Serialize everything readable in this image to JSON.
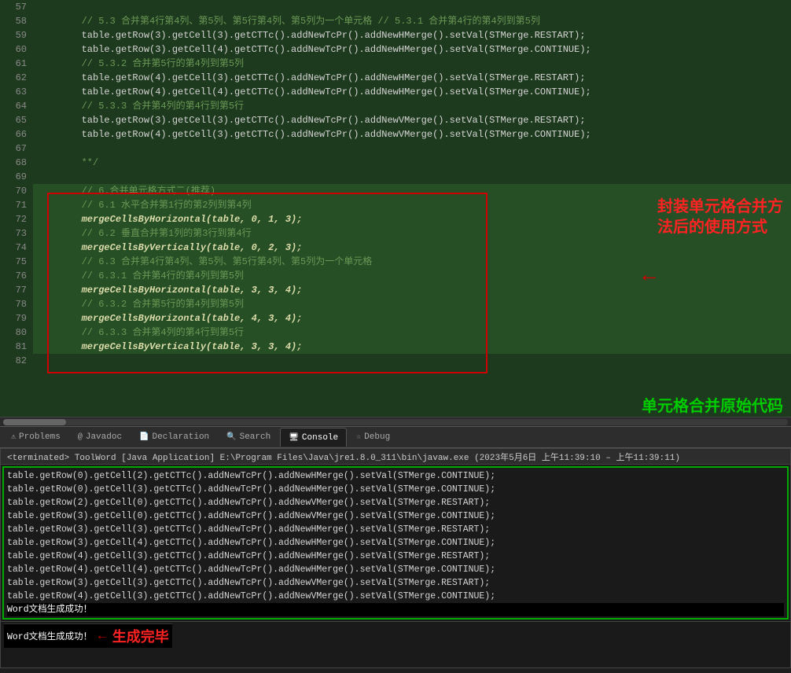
{
  "editor": {
    "lines": [
      {
        "num": "57",
        "content": "",
        "type": "normal"
      },
      {
        "num": "58",
        "content": "        // 5.3 合并第4行第4列、第5列、第5行第4列、第5列为一个单元格 // 5.3.1 合并第4行的第4列到第5列",
        "type": "comment"
      },
      {
        "num": "59",
        "content": "        table.getRow(3).getCell(3).getCTTc().addNewTcPr().addNewHMerge().setVal(STMerge.RESTART);",
        "type": "normal"
      },
      {
        "num": "60",
        "content": "        table.getRow(3).getCell(4).getCTTc().addNewTcPr().addNewHMerge().setVal(STMerge.CONTINUE);",
        "type": "normal"
      },
      {
        "num": "61",
        "content": "        // 5.3.2 合并第5行的第4列到第5列",
        "type": "comment"
      },
      {
        "num": "62",
        "content": "        table.getRow(4).getCell(3).getCTTc().addNewTcPr().addNewHMerge().setVal(STMerge.RESTART);",
        "type": "normal"
      },
      {
        "num": "63",
        "content": "        table.getRow(4).getCell(4).getCTTc().addNewTcPr().addNewHMerge().setVal(STMerge.CONTINUE);",
        "type": "normal"
      },
      {
        "num": "64",
        "content": "        // 5.3.3 合并第4列的第4行到第5行",
        "type": "comment"
      },
      {
        "num": "65",
        "content": "        table.getRow(3).getCell(3).getCTTc().addNewTcPr().addNewVMerge().setVal(STMerge.RESTART);",
        "type": "normal"
      },
      {
        "num": "66",
        "content": "        table.getRow(4).getCell(3).getCTTc().addNewTcPr().addNewVMerge().setVal(STMerge.CONTINUE);",
        "type": "normal"
      },
      {
        "num": "67",
        "content": "",
        "type": "normal"
      },
      {
        "num": "68",
        "content": "        **/",
        "type": "comment"
      },
      {
        "num": "69",
        "content": "",
        "type": "normal"
      },
      {
        "num": "70",
        "content": "        // 6.合并单元格方式二(推荐)",
        "type": "comment",
        "highlighted": true
      },
      {
        "num": "71",
        "content": "        // 6.1 水平合并第1行的第2列到第4列",
        "type": "comment",
        "highlighted": true
      },
      {
        "num": "72",
        "content": "        mergeCellsByHorizontal(table, 0, 1, 3);",
        "type": "method",
        "highlighted": true
      },
      {
        "num": "73",
        "content": "        // 6.2 垂直合并第1列的第3行到第4行",
        "type": "comment",
        "highlighted": true
      },
      {
        "num": "74",
        "content": "        mergeCellsByVertically(table, 0, 2, 3);",
        "type": "method",
        "highlighted": true
      },
      {
        "num": "75",
        "content": "        // 6.3 合并第4行第4列、第5列、第5行第4列、第5列为一个单元格",
        "type": "comment",
        "highlighted": true
      },
      {
        "num": "76",
        "content": "        // 6.3.1 合并第4行的第4列到第5列",
        "type": "comment",
        "highlighted": true
      },
      {
        "num": "77",
        "content": "        mergeCellsByHorizontal(table, 3, 3, 4);",
        "type": "method",
        "highlighted": true
      },
      {
        "num": "78",
        "content": "        // 6.3.2 合并第5行的第4列到第5列",
        "type": "comment",
        "highlighted": true
      },
      {
        "num": "79",
        "content": "        mergeCellsByHorizontal(table, 4, 3, 4);",
        "type": "method",
        "highlighted": true
      },
      {
        "num": "80",
        "content": "        // 6.3.3 合并第4列的第4行到第5行",
        "type": "comment",
        "highlighted": true
      },
      {
        "num": "81",
        "content": "        mergeCellsByVertically(table, 3, 3, 4);",
        "type": "method",
        "highlighted": true
      },
      {
        "num": "82",
        "content": "",
        "type": "normal"
      }
    ],
    "right_annotation": "封装单元格合并方法后的使用方式",
    "bottom_annotation": "单元格合并原始代码"
  },
  "tabs": [
    {
      "label": "Problems",
      "icon": "⚠",
      "active": false
    },
    {
      "label": "@ Javadoc",
      "icon": "",
      "active": false
    },
    {
      "label": "Declaration",
      "icon": "📄",
      "active": false
    },
    {
      "label": "Search",
      "icon": "🔍",
      "active": false
    },
    {
      "label": "Console",
      "icon": "🖥",
      "active": true
    },
    {
      "label": "☆ Debug",
      "icon": "",
      "active": false
    }
  ],
  "console": {
    "header": "<terminated> ToolWord [Java Application] E:\\Program Files\\Java\\jre1.8.0_311\\bin\\javaw.exe (2023年5月6日 上午11:39:10 – 上午11:39:11)",
    "lines": [
      "table.getRow(0).getCell(2).getCTTc().addNewTcPr().addNewHMerge().setVal(STMerge.CONTINUE);",
      "table.getRow(0).getCell(3).getCTTc().addNewTcPr().addNewHMerge().setVal(STMerge.CONTINUE);",
      "table.getRow(2).getCell(0).getCTTc().addNewTcPr().addNewVMerge().setVal(STMerge.RESTART);",
      "table.getRow(3).getCell(0).getCTTc().addNewTcPr().addNewVMerge().setVal(STMerge.CONTINUE);",
      "table.getRow(3).getCell(3).getCTTc().addNewTcPr().addNewHMerge().setVal(STMerge.RESTART);",
      "table.getRow(3).getCell(4).getCTTc().addNewTcPr().addNewHMerge().setVal(STMerge.CONTINUE);",
      "table.getRow(4).getCell(3).getCTTc().addNewTcPr().addNewHMerge().setVal(STMerge.RESTART);",
      "table.getRow(4).getCell(4).getCTTc().addNewTcPr().addNewHMerge().setVal(STMerge.CONTINUE);",
      "table.getRow(3).getCell(3).getCTTc().addNewTcPr().addNewVMerge().setVal(STMerge.RESTART);",
      "table.getRow(4).getCell(3).getCTTc().addNewTcPr().addNewVMerge().setVal(STMerge.CONTINUE);"
    ],
    "success_line": "Word文档生成成功！",
    "bottom_annotation": "生成完毕"
  }
}
